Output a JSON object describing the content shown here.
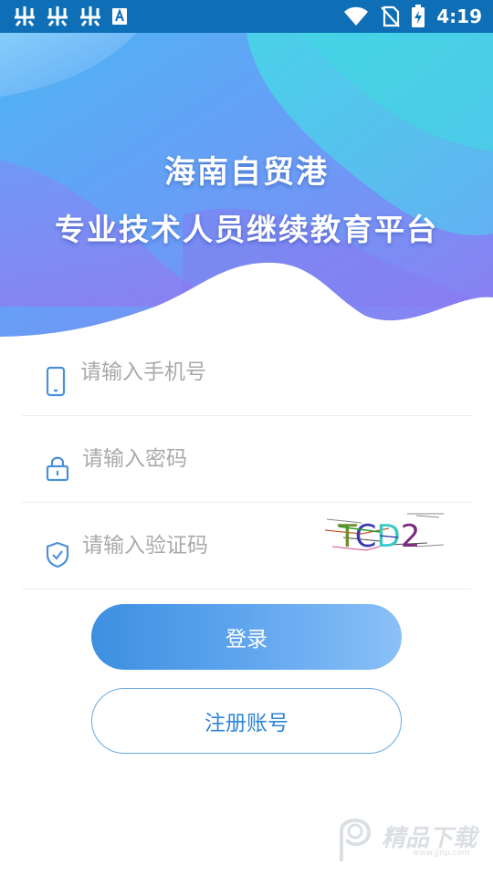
{
  "status_bar": {
    "time": "4:19",
    "left_icons": [
      "app-notification-icon",
      "app-notification-icon",
      "app-notification-icon",
      "font-a-icon"
    ],
    "right_icons": [
      "wifi-icon",
      "no-sim-icon",
      "battery-charging-icon"
    ]
  },
  "hero": {
    "title_line1": "海南自贸港",
    "title_line2": "专业技术人员继续教育平台",
    "colors": {
      "start": "#5aa6f5",
      "end": "#8a7af5",
      "accent": "#3cd0e8"
    }
  },
  "form": {
    "phone": {
      "placeholder": "请输入手机号",
      "value": "",
      "icon": "phone-icon"
    },
    "password": {
      "placeholder": "请输入密码",
      "value": "",
      "icon": "lock-icon"
    },
    "captcha": {
      "placeholder": "请输入验证码",
      "value": "",
      "icon": "shield-check-icon",
      "image_text": "TCD2"
    }
  },
  "buttons": {
    "login": "登录",
    "register": "注册账号"
  },
  "watermark": {
    "text": "精品下载",
    "url": "www.jjnp.com"
  },
  "colors": {
    "primary": "#2f86d6",
    "status_bar": "#0f6fb6",
    "icon": "#4a90d9",
    "placeholder": "#a9a9a9"
  }
}
